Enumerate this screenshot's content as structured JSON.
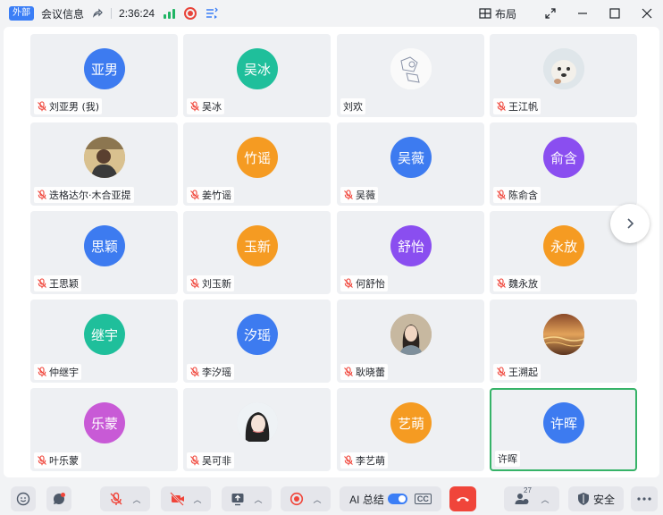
{
  "titlebar": {
    "tag": "外部",
    "meeting_info": "会议信息",
    "timer": "2:36:24",
    "layout_label": "布局"
  },
  "participants": [
    {
      "avatar_text": "亚男",
      "name": "刘亚男 (我)",
      "color": "#3d7bf0",
      "muted": true
    },
    {
      "avatar_text": "吴冰",
      "name": "吴冰",
      "color": "#1fbf9b",
      "muted": true
    },
    {
      "avatar_text": "",
      "name": "刘欢",
      "color": "#ffffff",
      "muted": false,
      "photo": "sketch"
    },
    {
      "avatar_text": "",
      "name": "王江帆",
      "color": "#dfe6ea",
      "muted": true,
      "photo": "dog"
    },
    {
      "avatar_text": "",
      "name": "迭格达尔·木合亚提",
      "color": "#c8a36a",
      "muted": true,
      "photo": "person1"
    },
    {
      "avatar_text": "竹谣",
      "name": "姜竹谣",
      "color": "#f59b22",
      "muted": true
    },
    {
      "avatar_text": "吴薇",
      "name": "吴薇",
      "color": "#3d7bf0",
      "muted": true
    },
    {
      "avatar_text": "俞含",
      "name": "陈俞含",
      "color": "#8a4ef0",
      "muted": true
    },
    {
      "avatar_text": "思颖",
      "name": "王思颖",
      "color": "#3d7bf0",
      "muted": true
    },
    {
      "avatar_text": "玉新",
      "name": "刘玉新",
      "color": "#f59b22",
      "muted": true
    },
    {
      "avatar_text": "舒怡",
      "name": "何舒怡",
      "color": "#8a4ef0",
      "muted": true
    },
    {
      "avatar_text": "永放",
      "name": "魏永放",
      "color": "#f59b22",
      "muted": true
    },
    {
      "avatar_text": "继宇",
      "name": "仲继宇",
      "color": "#1fbf9b",
      "muted": true
    },
    {
      "avatar_text": "汐瑶",
      "name": "李汐瑶",
      "color": "#3d7bf0",
      "muted": true
    },
    {
      "avatar_text": "",
      "name": "耿晓蕾",
      "color": "#b9a58c",
      "muted": true,
      "photo": "person2"
    },
    {
      "avatar_text": "",
      "name": "王溯起",
      "color": "#c07a3c",
      "muted": true,
      "photo": "sunset"
    },
    {
      "avatar_text": "乐蒙",
      "name": "叶乐蒙",
      "color": "#c85ad6",
      "muted": true
    },
    {
      "avatar_text": "",
      "name": "吴可非",
      "color": "#d9dde3",
      "muted": true,
      "photo": "person3"
    },
    {
      "avatar_text": "艺萌",
      "name": "李艺萌",
      "color": "#f59b22",
      "muted": true
    },
    {
      "avatar_text": "许晖",
      "name": "许晖",
      "color": "#3d7bf0",
      "muted": false,
      "speaking": true
    }
  ],
  "toolbar": {
    "ai_label": "AI 总结",
    "cc_label": "CC",
    "participants_count": "27",
    "security_label": "安全"
  }
}
